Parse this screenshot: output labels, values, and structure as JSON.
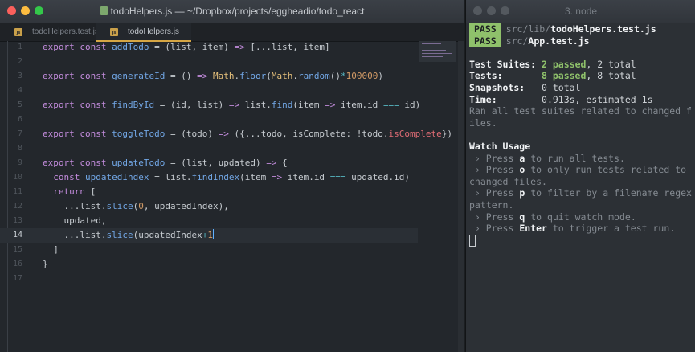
{
  "editor": {
    "title": "todoHelpers.js — ~/Dropbox/projects/eggheadio/todo_react",
    "tabs": [
      {
        "label": "todoHelpers.test.js",
        "icon": "js"
      },
      {
        "label": "todoHelpers.js",
        "icon": "js"
      }
    ],
    "current_line": "14",
    "lines": [
      {
        "n": "1"
      },
      {
        "n": "2"
      },
      {
        "n": "3"
      },
      {
        "n": "4"
      },
      {
        "n": "5"
      },
      {
        "n": "6"
      },
      {
        "n": "7"
      },
      {
        "n": "8"
      },
      {
        "n": "9"
      },
      {
        "n": "10"
      },
      {
        "n": "11"
      },
      {
        "n": "12"
      },
      {
        "n": "13"
      },
      {
        "n": "14"
      },
      {
        "n": "15"
      },
      {
        "n": "16"
      },
      {
        "n": "17"
      }
    ],
    "tokens": {
      "exp": "export",
      "cst": "const",
      "ret": "return",
      "addTodo": "addTodo",
      "generateId": "generateId",
      "findById": "findById",
      "toggleTodo": "toggleTodo",
      "updateTodo": "updateTodo",
      "updatedIndex": "updatedIndex",
      "math1": "Math",
      "floor": "floor",
      "math2": "Math",
      "random": "random",
      "num100000": "100000",
      "find": "find",
      "findIndex": "findIndex",
      "slice1": "slice",
      "slice2": "slice",
      "zero": "0",
      "one": "1",
      "isComplete": "isComplete",
      "l1a": " = (list, item) ",
      "l1b": " [...list, item]",
      "l3a": " = () ",
      "l3b": "(",
      "l3c": "()",
      "l3d": ")",
      "l5a": " = (id, list) ",
      "l5b": " list.",
      "l5c": "(item ",
      "l5d": " item.id ",
      "l5e": " id)",
      "l7a": " = (todo) ",
      "l7b": " ({...todo, isComplete: !todo.",
      "l7c": "})",
      "l9a": " = (list, updated) ",
      "l9b": " {",
      "l10a": " = list.",
      "l10b": "(item ",
      "l10c": " item.id ",
      "l10d": " updated.id)",
      "l11a": " [",
      "l12a": "...list.",
      "l12b": "(",
      "l12c": ", updatedIndex),",
      "l13": "updated,",
      "l14a": "...list.",
      "l14b": "(updatedIndex",
      "l15": "]",
      "l16": "}",
      "eq": "=",
      "arrow": "=>",
      "arrow2": "=>",
      "arrow3": "=>",
      "arrow4": "=>",
      "arrow5": "=>",
      "arrow6": "=>",
      "arrow7": "=>",
      "eqeq": "===",
      "eqeq2": "===",
      "star": "*",
      "plus": "+"
    }
  },
  "terminal": {
    "title": "3. node",
    "pass_label": "PASS",
    "results": [
      {
        "dir": "src/lib/",
        "file": "todoHelpers.test.js"
      },
      {
        "dir": "src/",
        "file": "App.test.js"
      }
    ],
    "summary": {
      "suites_label": "Test Suites:",
      "suites_passed": "2 passed",
      "suites_total": ", 2 total",
      "tests_label": "Tests:",
      "tests_passed": "8 passed",
      "tests_total": ", 8 total",
      "snapshots_label": "Snapshots:",
      "snapshots_value": "0 total",
      "time_label": "Time:",
      "time_value": "0.913s, estimated 1s",
      "ran_all": "Ran all test suites related to changed files."
    },
    "watch": {
      "heading": "Watch Usage",
      "items": [
        {
          "pre": " › Press ",
          "key": "a",
          "post": " to run all tests."
        },
        {
          "pre": " › Press ",
          "key": "o",
          "post": " to only run tests related to changed files."
        },
        {
          "pre": " › Press ",
          "key": "p",
          "post": " to filter by a filename regex pattern."
        },
        {
          "pre": " › Press ",
          "key": "q",
          "post": " to quit watch mode."
        },
        {
          "pre": " › Press ",
          "key": "Enter",
          "post": " to trigger a test run."
        }
      ]
    }
  },
  "colors": {
    "keyword": "#c38cdd",
    "function": "#72a7e6",
    "type": "#e5c07b",
    "number": "#d19a66",
    "operator": "#56b6c2",
    "pass_badge": "#8fc16b",
    "tab_accent": "#d6a644",
    "close_light": "#fc605c",
    "minimize_light": "#fdbc40",
    "zoom_light": "#34c84a"
  }
}
